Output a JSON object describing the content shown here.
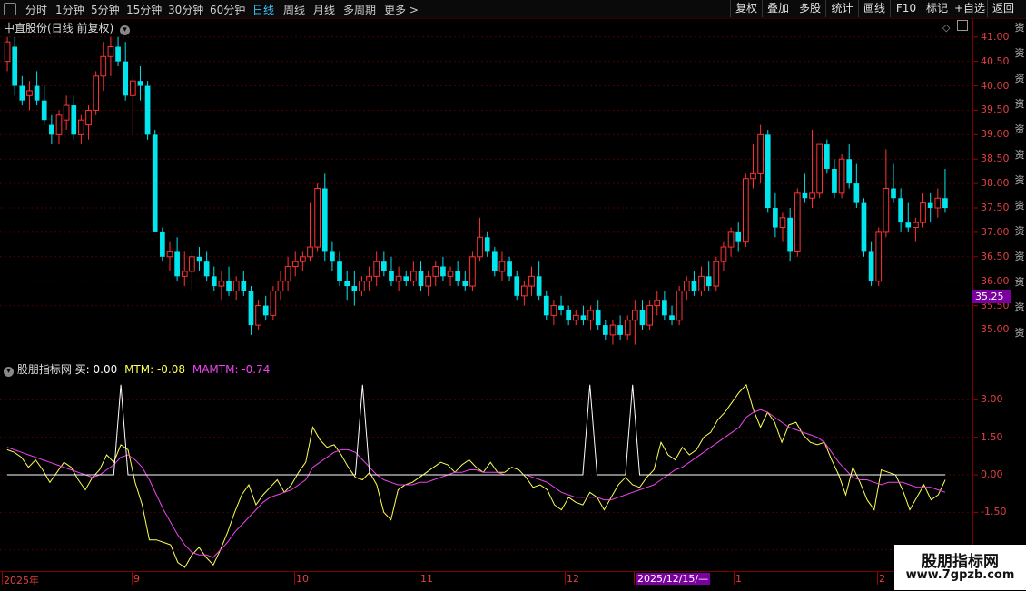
{
  "periods": [
    "分时",
    "1分钟",
    "5分钟",
    "15分钟",
    "30分钟",
    "60分钟",
    "日线",
    "周线",
    "月线",
    "多周期",
    "更多 >"
  ],
  "active_period": "日线",
  "tools": [
    "复权",
    "叠加",
    "多股",
    "统计",
    "画线",
    "F10",
    "标记",
    "+自选",
    "返回"
  ],
  "stock_title": "中直股份(日线 前复权)",
  "price_ticks": [
    "41.00",
    "40.50",
    "40.00",
    "39.50",
    "39.00",
    "38.50",
    "38.00",
    "37.50",
    "37.00",
    "36.50",
    "36.00",
    "35.50",
    "35.00"
  ],
  "current_price": "35.25",
  "indicator": {
    "name": "股朋指标网",
    "buy": "买: 0.00",
    "mtm": "MTM: -0.08",
    "mamtm": "MAMTM: -0.74"
  },
  "ind_ticks": [
    "3.00",
    "1.50",
    "0.00",
    "-1.50",
    "-3.00"
  ],
  "time_labels": [
    "2025年",
    "9",
    "10",
    "11",
    "12",
    "2025/12/15/—",
    "1",
    "2"
  ],
  "watermark": {
    "line1": "股朋指标网",
    "line2": "www.7gpzb.com"
  },
  "side_chars": [
    "资",
    "资",
    "资",
    "资",
    "资",
    "资",
    "资",
    "资",
    "资",
    "资",
    "资",
    "资",
    "资"
  ],
  "colors": {
    "up": "#ff3333",
    "down": "#00e5ee",
    "mtm": "#ffff55",
    "mamtm": "#ee44ee",
    "buy": "#ffffff"
  },
  "chart_data": [
    {
      "type": "candlestick",
      "title": "中直股份(日线 前复权)",
      "ylim": [
        34.6,
        41.2
      ],
      "ohlc": [
        [
          40.5,
          41.0,
          40.3,
          40.9
        ],
        [
          40.8,
          41.0,
          39.8,
          40.0
        ],
        [
          40.0,
          40.2,
          39.6,
          39.7
        ],
        [
          39.8,
          40.1,
          39.5,
          39.9
        ],
        [
          40.0,
          40.3,
          39.6,
          39.7
        ],
        [
          39.7,
          40.0,
          39.2,
          39.3
        ],
        [
          39.2,
          39.4,
          38.8,
          39.0
        ],
        [
          39.0,
          39.5,
          38.8,
          39.4
        ],
        [
          39.3,
          39.8,
          39.1,
          39.6
        ],
        [
          39.6,
          39.8,
          38.9,
          39.0
        ],
        [
          39.0,
          39.4,
          38.8,
          39.3
        ],
        [
          39.2,
          39.6,
          38.9,
          39.5
        ],
        [
          39.5,
          40.3,
          39.4,
          40.2
        ],
        [
          40.2,
          40.9,
          39.9,
          40.6
        ],
        [
          40.6,
          41.0,
          40.2,
          40.8
        ],
        [
          40.8,
          41.0,
          40.4,
          40.5
        ],
        [
          40.5,
          40.9,
          39.7,
          39.8
        ],
        [
          39.8,
          40.2,
          39.0,
          40.1
        ],
        [
          40.1,
          40.4,
          39.7,
          40.0
        ],
        [
          40.0,
          40.1,
          38.9,
          39.0
        ],
        [
          39.0,
          39.1,
          37.0,
          37.0
        ],
        [
          37.0,
          37.1,
          36.4,
          36.5
        ],
        [
          36.5,
          36.8,
          36.2,
          36.6
        ],
        [
          36.6,
          36.9,
          36.0,
          36.1
        ],
        [
          36.1,
          36.6,
          35.9,
          36.2
        ],
        [
          36.2,
          36.6,
          35.8,
          36.5
        ],
        [
          36.5,
          36.7,
          36.2,
          36.4
        ],
        [
          36.4,
          36.6,
          36.0,
          36.1
        ],
        [
          36.1,
          36.3,
          35.8,
          35.9
        ],
        [
          35.9,
          36.2,
          35.6,
          36.0
        ],
        [
          36.0,
          36.3,
          35.7,
          35.8
        ],
        [
          35.8,
          36.1,
          35.6,
          36.0
        ],
        [
          36.0,
          36.2,
          35.7,
          35.8
        ],
        [
          35.8,
          35.9,
          34.9,
          35.1
        ],
        [
          35.1,
          35.6,
          35.0,
          35.5
        ],
        [
          35.5,
          35.7,
          35.2,
          35.3
        ],
        [
          35.3,
          35.9,
          35.2,
          35.8
        ],
        [
          35.8,
          36.2,
          35.6,
          36.0
        ],
        [
          36.0,
          36.5,
          35.8,
          36.3
        ],
        [
          36.3,
          36.6,
          36.1,
          36.4
        ],
        [
          36.4,
          36.6,
          36.2,
          36.5
        ],
        [
          36.5,
          37.6,
          36.4,
          36.7
        ],
        [
          36.7,
          38.0,
          36.6,
          37.9
        ],
        [
          37.9,
          38.2,
          36.4,
          36.6
        ],
        [
          36.6,
          36.8,
          36.2,
          36.4
        ],
        [
          36.4,
          36.6,
          35.9,
          36.0
        ],
        [
          36.0,
          36.2,
          35.6,
          35.9
        ],
        [
          35.9,
          36.2,
          35.5,
          35.8
        ],
        [
          35.8,
          36.1,
          35.7,
          36.0
        ],
        [
          36.0,
          36.3,
          35.8,
          36.1
        ],
        [
          36.1,
          36.6,
          35.9,
          36.4
        ],
        [
          36.4,
          36.6,
          36.1,
          36.2
        ],
        [
          36.2,
          36.5,
          35.9,
          36.0
        ],
        [
          36.0,
          36.3,
          35.8,
          36.1
        ],
        [
          36.1,
          36.2,
          35.9,
          36.0
        ],
        [
          36.0,
          36.4,
          35.9,
          36.2
        ],
        [
          36.2,
          36.4,
          35.8,
          35.9
        ],
        [
          35.9,
          36.2,
          35.7,
          36.1
        ],
        [
          36.1,
          36.4,
          35.9,
          36.3
        ],
        [
          36.3,
          36.5,
          36.0,
          36.1
        ],
        [
          36.1,
          36.3,
          35.9,
          36.2
        ],
        [
          36.2,
          36.4,
          35.9,
          36.0
        ],
        [
          36.0,
          36.2,
          35.8,
          35.9
        ],
        [
          35.9,
          36.6,
          35.8,
          36.5
        ],
        [
          36.5,
          37.3,
          36.4,
          36.9
        ],
        [
          36.9,
          37.0,
          36.5,
          36.6
        ],
        [
          36.6,
          36.7,
          36.1,
          36.2
        ],
        [
          36.2,
          36.6,
          36.0,
          36.4
        ],
        [
          36.4,
          36.5,
          36.0,
          36.1
        ],
        [
          36.1,
          36.2,
          35.6,
          35.7
        ],
        [
          35.7,
          36.0,
          35.5,
          35.9
        ],
        [
          35.9,
          36.3,
          35.7,
          36.1
        ],
        [
          36.1,
          36.4,
          35.6,
          35.7
        ],
        [
          35.7,
          35.8,
          35.2,
          35.3
        ],
        [
          35.3,
          35.6,
          35.1,
          35.5
        ],
        [
          35.5,
          35.7,
          35.3,
          35.4
        ],
        [
          35.4,
          35.5,
          35.1,
          35.2
        ],
        [
          35.2,
          35.4,
          35.1,
          35.3
        ],
        [
          35.3,
          35.5,
          35.1,
          35.2
        ],
        [
          35.2,
          35.5,
          35.0,
          35.4
        ],
        [
          35.4,
          35.6,
          35.0,
          35.1
        ],
        [
          35.1,
          35.2,
          34.8,
          34.9
        ],
        [
          34.9,
          35.2,
          34.7,
          35.1
        ],
        [
          35.1,
          35.3,
          34.8,
          34.9
        ],
        [
          34.9,
          35.3,
          34.8,
          35.2
        ],
        [
          35.2,
          35.6,
          34.7,
          35.4
        ],
        [
          35.4,
          35.6,
          35.0,
          35.1
        ],
        [
          35.1,
          35.6,
          35.0,
          35.5
        ],
        [
          35.5,
          35.8,
          35.3,
          35.6
        ],
        [
          35.6,
          35.8,
          35.2,
          35.3
        ],
        [
          35.3,
          35.5,
          35.1,
          35.2
        ],
        [
          35.2,
          35.9,
          35.1,
          35.8
        ],
        [
          35.8,
          36.1,
          35.6,
          36.0
        ],
        [
          36.0,
          36.2,
          35.7,
          35.8
        ],
        [
          35.8,
          36.3,
          35.7,
          36.1
        ],
        [
          36.1,
          36.4,
          35.8,
          35.9
        ],
        [
          35.9,
          36.5,
          35.8,
          36.4
        ],
        [
          36.4,
          36.8,
          36.2,
          36.7
        ],
        [
          36.7,
          37.1,
          36.5,
          37.0
        ],
        [
          37.0,
          37.2,
          36.6,
          36.8
        ],
        [
          36.8,
          38.2,
          36.7,
          38.1
        ],
        [
          38.1,
          38.8,
          37.9,
          38.2
        ],
        [
          38.2,
          39.2,
          38.0,
          39.0
        ],
        [
          39.0,
          39.1,
          37.4,
          37.5
        ],
        [
          37.5,
          37.8,
          36.9,
          37.1
        ],
        [
          37.1,
          37.4,
          36.8,
          37.3
        ],
        [
          37.3,
          37.5,
          36.4,
          36.6
        ],
        [
          36.6,
          37.9,
          36.5,
          37.8
        ],
        [
          37.8,
          38.2,
          37.6,
          37.7
        ],
        [
          37.7,
          39.1,
          37.5,
          37.8
        ],
        [
          37.8,
          38.8,
          37.7,
          38.8
        ],
        [
          38.8,
          38.9,
          38.2,
          38.3
        ],
        [
          38.3,
          38.5,
          37.7,
          37.8
        ],
        [
          37.8,
          38.6,
          37.7,
          38.5
        ],
        [
          38.5,
          38.8,
          37.9,
          38.0
        ],
        [
          38.0,
          38.4,
          37.5,
          37.6
        ],
        [
          37.6,
          37.7,
          36.5,
          36.6
        ],
        [
          36.6,
          36.8,
          35.9,
          36.0
        ],
        [
          36.0,
          37.1,
          35.9,
          37.0
        ],
        [
          37.0,
          38.7,
          36.9,
          37.9
        ],
        [
          37.9,
          38.4,
          37.6,
          37.7
        ],
        [
          37.7,
          37.9,
          37.0,
          37.2
        ],
        [
          37.2,
          37.6,
          37.0,
          37.1
        ],
        [
          37.1,
          37.3,
          36.8,
          37.2
        ],
        [
          37.2,
          37.8,
          37.1,
          37.6
        ],
        [
          37.6,
          37.8,
          37.2,
          37.5
        ],
        [
          37.5,
          37.9,
          37.3,
          37.7
        ],
        [
          37.7,
          38.3,
          37.4,
          37.5
        ]
      ]
    },
    {
      "type": "line",
      "title": "股朋指标网",
      "ylim": [
        -3.7,
        4.1
      ],
      "series": [
        {
          "name": "MTM",
          "values": [
            1.0,
            0.9,
            0.7,
            0.3,
            0.6,
            0.2,
            -0.3,
            0.1,
            0.5,
            0.3,
            -0.2,
            -0.6,
            -0.1,
            0.2,
            0.8,
            0.5,
            1.2,
            1.0,
            -0.3,
            -1.2,
            -2.6,
            -2.6,
            -2.7,
            -2.8,
            -3.5,
            -3.7,
            -3.2,
            -2.9,
            -3.3,
            -3.6,
            -3.0,
            -2.3,
            -1.5,
            -0.8,
            -0.4,
            -1.2,
            -0.8,
            -0.5,
            -0.2,
            -0.7,
            -0.4,
            0.1,
            0.5,
            1.9,
            1.4,
            1.1,
            1.2,
            0.8,
            0.3,
            -0.1,
            -0.2,
            0.1,
            -0.4,
            -1.5,
            -1.8,
            -0.6,
            -0.4,
            -0.3,
            -0.1,
            0.1,
            0.3,
            0.5,
            0.4,
            0.1,
            0.4,
            0.6,
            0.3,
            0.1,
            0.5,
            0.1,
            0.1,
            0.3,
            0.2,
            -0.1,
            -0.5,
            -0.4,
            -0.6,
            -1.2,
            -1.4,
            -0.9,
            -1.1,
            -1.2,
            -0.7,
            -0.9,
            -1.4,
            -0.9,
            -0.4,
            -0.1,
            -0.4,
            -0.5,
            -0.1,
            0.2,
            1.3,
            0.8,
            0.6,
            1.1,
            0.8,
            1.0,
            1.5,
            1.7,
            2.2,
            2.5,
            2.9,
            3.3,
            3.6,
            2.6,
            1.9,
            2.5,
            2.1,
            1.3,
            2.0,
            2.1,
            1.6,
            1.3,
            1.2,
            1.3,
            0.6,
            0.0,
            -0.8,
            0.3,
            -0.3,
            -1.0,
            -1.4,
            0.2,
            0.1,
            0.0,
            -0.6,
            -1.4,
            -0.9,
            -0.4,
            -1.0,
            -0.8,
            -0.2
          ]
        },
        {
          "name": "MAMTM",
          "values": [
            1.1,
            1.0,
            0.9,
            0.8,
            0.7,
            0.6,
            0.5,
            0.4,
            0.3,
            0.2,
            0.1,
            0.0,
            -0.1,
            0.0,
            0.2,
            0.4,
            0.7,
            0.8,
            0.6,
            0.3,
            -0.2,
            -0.8,
            -1.4,
            -1.9,
            -2.4,
            -2.8,
            -3.1,
            -3.2,
            -3.2,
            -3.3,
            -3.0,
            -2.7,
            -2.3,
            -2.0,
            -1.7,
            -1.4,
            -1.1,
            -0.9,
            -0.8,
            -0.7,
            -0.6,
            -0.4,
            -0.2,
            0.3,
            0.5,
            0.7,
            0.9,
            1.0,
            1.0,
            0.9,
            0.6,
            0.3,
            0.0,
            -0.2,
            -0.3,
            -0.4,
            -0.4,
            -0.4,
            -0.3,
            -0.3,
            -0.2,
            -0.1,
            0.0,
            0.1,
            0.1,
            0.2,
            0.2,
            0.1,
            0.1,
            0.1,
            0.0,
            0.0,
            0.0,
            0.0,
            -0.1,
            -0.2,
            -0.3,
            -0.5,
            -0.7,
            -0.8,
            -0.9,
            -0.9,
            -0.9,
            -0.9,
            -1.0,
            -1.0,
            -0.9,
            -0.8,
            -0.7,
            -0.6,
            -0.5,
            -0.4,
            -0.2,
            0.0,
            0.2,
            0.3,
            0.5,
            0.7,
            0.9,
            1.1,
            1.3,
            1.5,
            1.7,
            1.9,
            2.3,
            2.5,
            2.6,
            2.5,
            2.3,
            2.1,
            1.9,
            1.8,
            1.7,
            1.6,
            1.5,
            1.3,
            0.9,
            0.5,
            0.2,
            -0.1,
            -0.2,
            -0.2,
            -0.3,
            -0.4,
            -0.3,
            -0.3,
            -0.3,
            -0.4,
            -0.5,
            -0.5,
            -0.5,
            -0.6,
            -0.7
          ]
        },
        {
          "name": "买",
          "values": [
            0,
            0,
            0,
            0,
            0,
            0,
            0,
            0,
            0,
            0,
            0,
            0,
            0,
            0,
            0,
            0,
            1,
            0,
            0,
            0,
            0,
            0,
            0,
            0,
            0,
            0,
            0,
            0,
            0,
            0,
            0,
            0,
            0,
            0,
            0,
            0,
            0,
            0,
            0,
            0,
            0,
            0,
            0,
            0,
            0,
            0,
            0,
            0,
            0,
            0,
            1,
            0,
            0,
            0,
            0,
            0,
            0,
            0,
            0,
            0,
            0,
            0,
            0,
            0,
            0,
            0,
            0,
            0,
            0,
            0,
            0,
            0,
            0,
            0,
            0,
            0,
            0,
            0,
            0,
            0,
            0,
            0,
            1,
            0,
            0,
            0,
            0,
            0,
            1,
            0,
            0,
            0,
            0,
            0,
            0,
            0,
            0,
            0,
            0,
            0,
            0,
            0,
            0,
            0,
            0,
            0,
            0,
            0,
            0,
            0,
            0,
            0,
            0,
            0,
            0,
            0,
            0,
            0,
            0,
            0,
            0,
            0,
            0,
            0,
            0,
            0,
            0,
            0,
            0,
            0,
            0,
            0,
            0
          ]
        }
      ]
    }
  ]
}
